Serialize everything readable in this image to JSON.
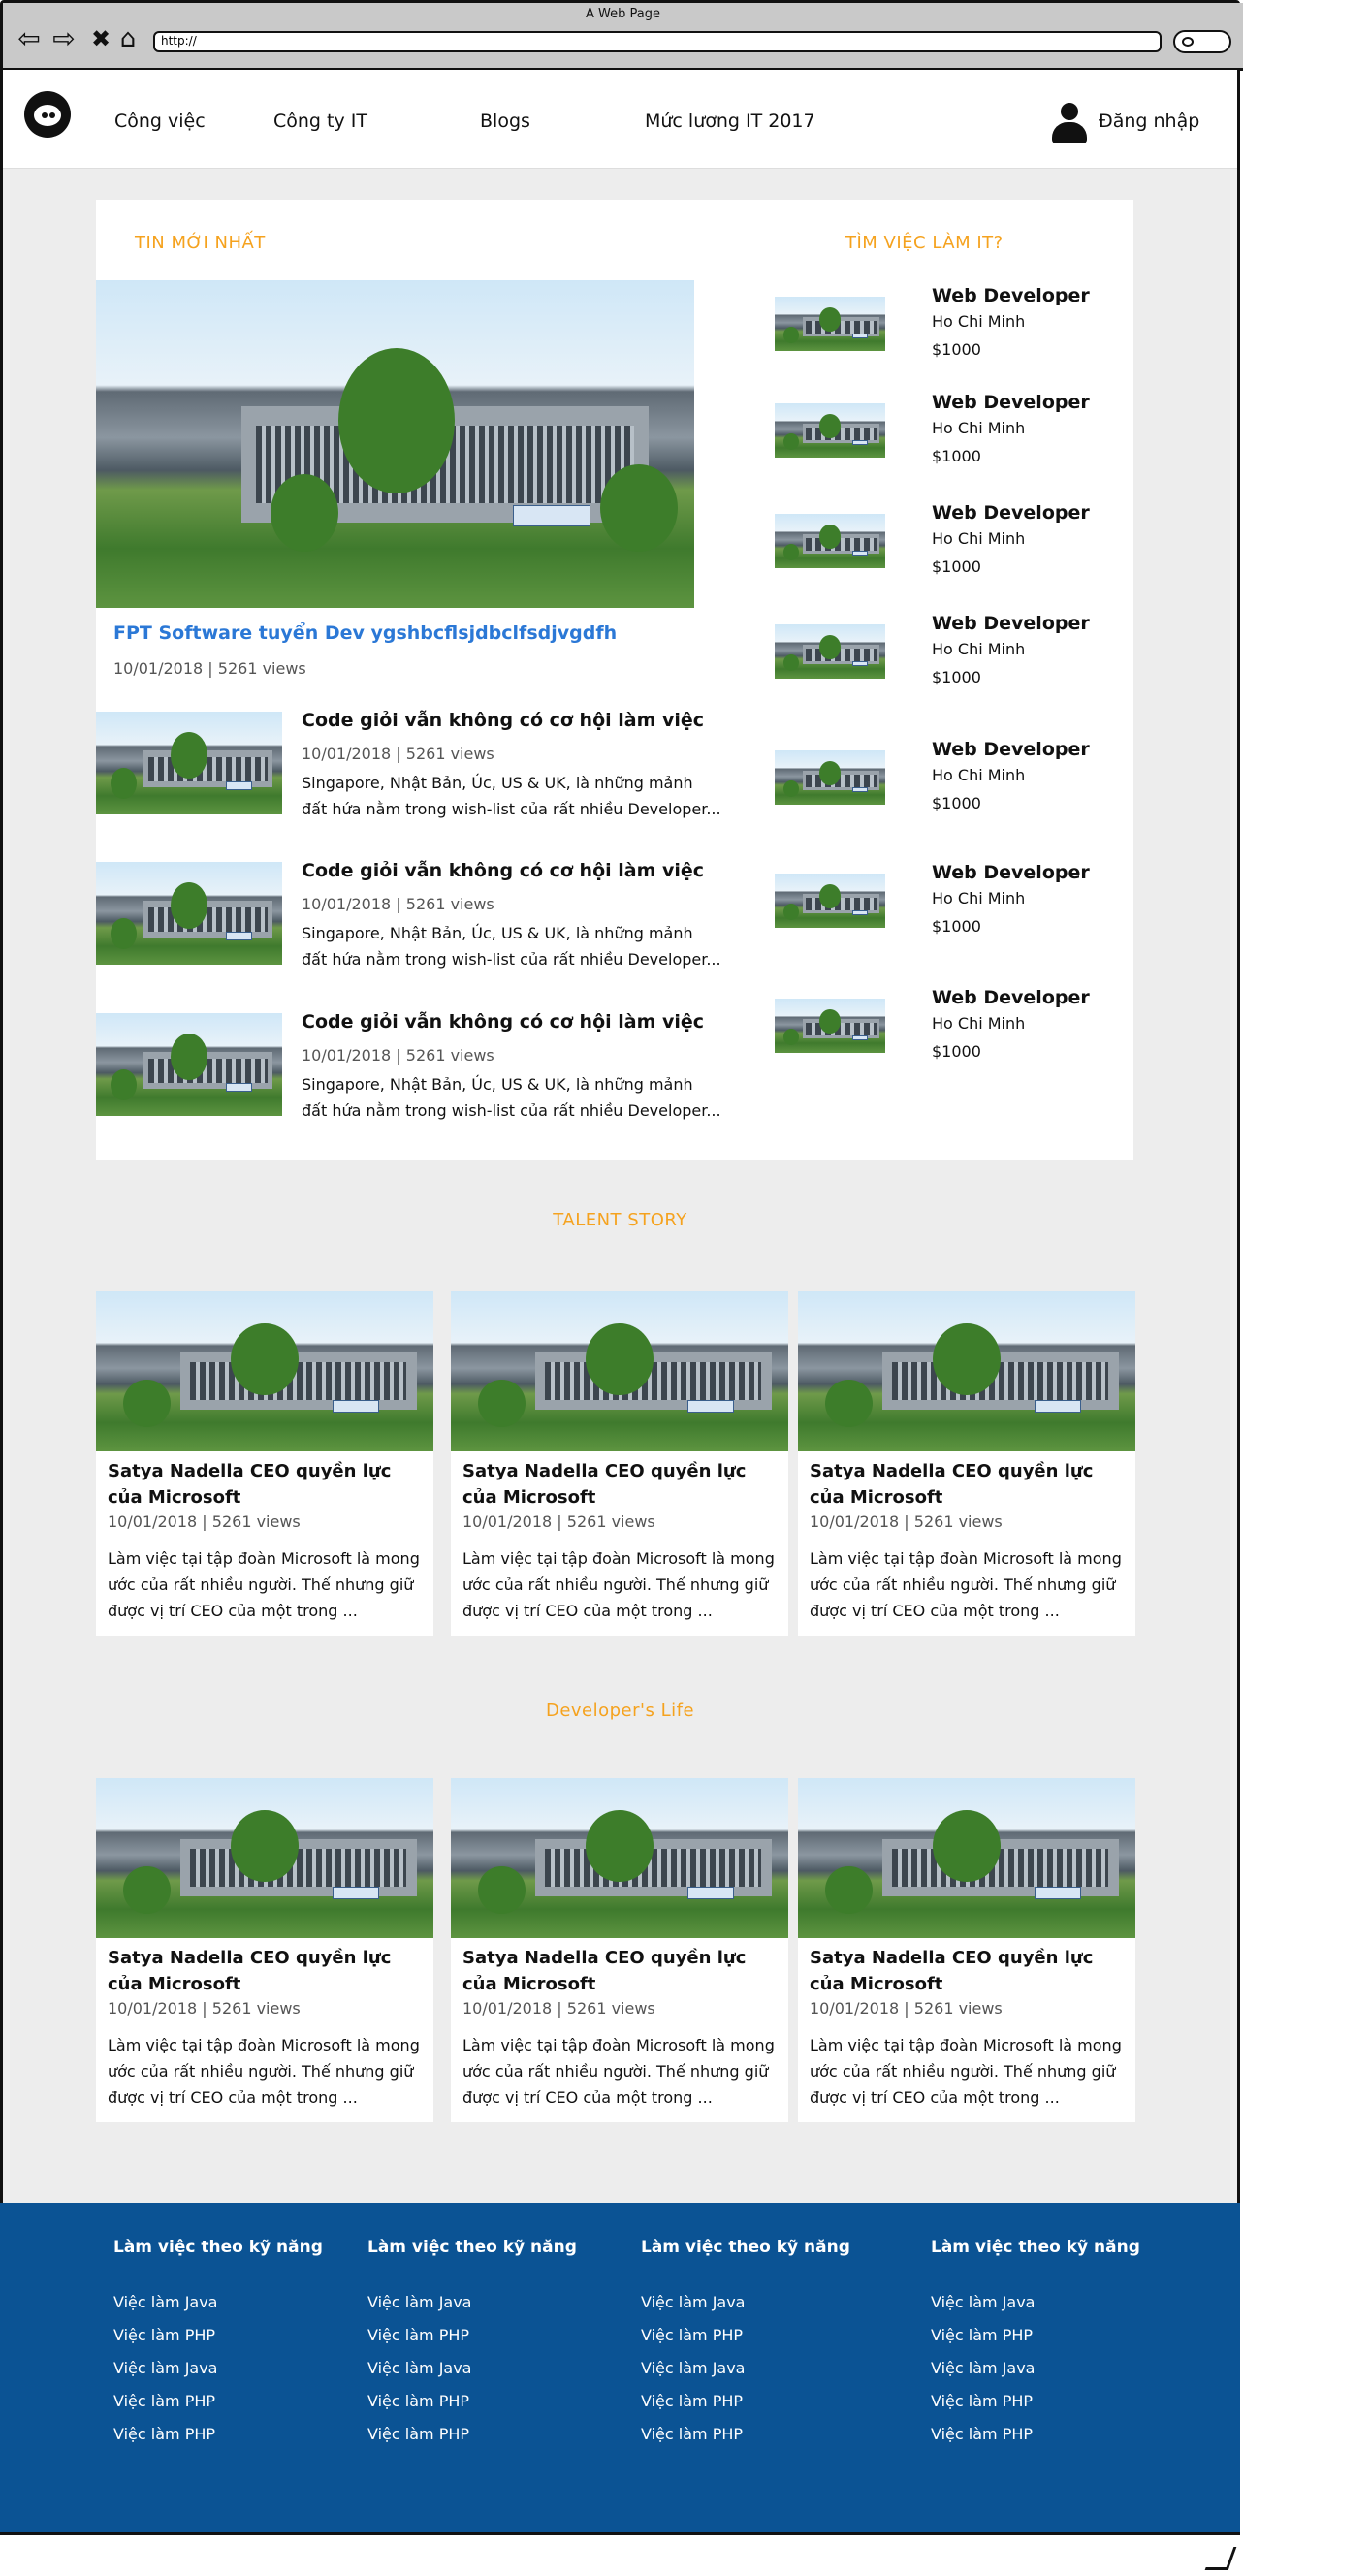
{
  "browser": {
    "title": "A Web Page",
    "address": "http://"
  },
  "header": {
    "menu": [
      "Công việc",
      "Công ty IT",
      "Blogs",
      "Mức lương IT 2017"
    ],
    "login": "Đăng nhập"
  },
  "news": {
    "section_title": "TIN MỚI NHẤT",
    "featured": {
      "title": "FPT Software tuyển Dev ygshbcflsjdbclfsdjvgdfh",
      "meta": "10/01/2018 | 5261 views"
    },
    "articles": [
      {
        "title": "Code giỏi vẫn không có cơ hội làm việc n...",
        "meta": "10/01/2018 | 5261 views",
        "desc1": "Singapore, Nhật Bản, Úc, US & UK, là những mảnh",
        "desc2": "đất hứa nằm trong wish-list của rất nhiều Developer..."
      },
      {
        "title": "Code giỏi vẫn không có cơ hội làm việc n...",
        "meta": "10/01/2018 | 5261 views",
        "desc1": "Singapore, Nhật Bản, Úc, US & UK, là những mảnh",
        "desc2": "đất hứa nằm trong wish-list của rất nhiều Developer..."
      },
      {
        "title": "Code giỏi vẫn không có cơ hội làm việc n...",
        "meta": "10/01/2018 | 5261 views",
        "desc1": "Singapore, Nhật Bản, Úc, US & UK, là những mảnh",
        "desc2": "đất hứa nằm trong wish-list của rất nhiều Developer..."
      }
    ]
  },
  "jobs": {
    "section_title": "TÌM VIỆC LÀM IT?",
    "items": [
      {
        "title": "Web Developer",
        "location": "Ho Chi Minh",
        "salary": "$1000"
      },
      {
        "title": "Web Developer",
        "location": "Ho Chi Minh",
        "salary": "$1000"
      },
      {
        "title": "Web Developer",
        "location": "Ho Chi Minh",
        "salary": "$1000"
      },
      {
        "title": "Web Developer",
        "location": "Ho Chi Minh",
        "salary": "$1000"
      },
      {
        "title": "Web Developer",
        "location": "Ho Chi Minh",
        "salary": "$1000"
      },
      {
        "title": "Web Developer",
        "location": "Ho Chi Minh",
        "salary": "$1000"
      },
      {
        "title": "Web Developer",
        "location": "Ho Chi Minh",
        "salary": "$1000"
      }
    ]
  },
  "talent": {
    "section_title": "TALENT STORY",
    "cards": [
      {
        "title": "Satya Nadella CEO quyền lực của Microsoft",
        "meta": "10/01/2018 | 5261 views",
        "desc": " Làm việc tại tập đoàn Microsoft là mong ước của rất nhiều người. Thế nhưng giữ được vị trí CEO của một trong ..."
      },
      {
        "title": "Satya Nadella CEO quyền lực của Microsoft",
        "meta": "10/01/2018 | 5261 views",
        "desc": " Làm việc tại tập đoàn Microsoft là mong ước của rất nhiều người. Thế nhưng giữ được vị trí CEO của một trong ..."
      },
      {
        "title": "Satya Nadella CEO quyền lực của Microsoft",
        "meta": "10/01/2018 | 5261 views",
        "desc": " Làm việc tại tập đoàn Microsoft là mong ước của rất nhiều người. Thế nhưng giữ được vị trí CEO của một trong ..."
      }
    ]
  },
  "devlife": {
    "section_title": "Developer's Life",
    "cards": [
      {
        "title": "Satya Nadella CEO quyền lực của Microsoft",
        "meta": "10/01/2018 | 5261 views",
        "desc": " Làm việc tại tập đoàn Microsoft là mong ước của rất nhiều người. Thế nhưng giữ được vị trí CEO của một trong ..."
      },
      {
        "title": "Satya Nadella CEO quyền lực của Microsoft",
        "meta": "10/01/2018 | 5261 views",
        "desc": " Làm việc tại tập đoàn Microsoft là mong ước của rất nhiều người. Thế nhưng giữ được vị trí CEO của một trong ..."
      },
      {
        "title": "Satya Nadella CEO quyền lực của Microsoft",
        "meta": "10/01/2018 | 5261 views",
        "desc": " Làm việc tại tập đoàn Microsoft là mong ước của rất nhiều người. Thế nhưng giữ được vị trí CEO của một trong ..."
      }
    ]
  },
  "footer": {
    "columns": [
      {
        "heading": "Làm việc theo kỹ năng",
        "links": [
          "Việc làm Java",
          "Việc làm PHP",
          "Việc làm Java",
          "Việc làm PHP",
          "Việc làm PHP"
        ]
      },
      {
        "heading": "Làm việc theo kỹ năng",
        "links": [
          "Việc làm Java",
          "Việc làm PHP",
          "Việc làm Java",
          "Việc làm PHP",
          "Việc làm PHP"
        ]
      },
      {
        "heading": "Làm việc theo kỹ năng",
        "links": [
          "Việc làm Java",
          "Việc làm PHP",
          "Việc làm Java",
          "Việc làm PHP",
          "Việc làm PHP"
        ]
      },
      {
        "heading": "Làm việc theo kỹ năng",
        "links": [
          "Việc làm Java",
          "Việc làm PHP",
          "Việc làm Java",
          "Việc làm PHP",
          "Việc làm PHP"
        ]
      }
    ]
  },
  "colors": {
    "accent": "#f5a21e",
    "link": "#2b78d6",
    "footer": "#0b5394",
    "background": "#ededed"
  }
}
